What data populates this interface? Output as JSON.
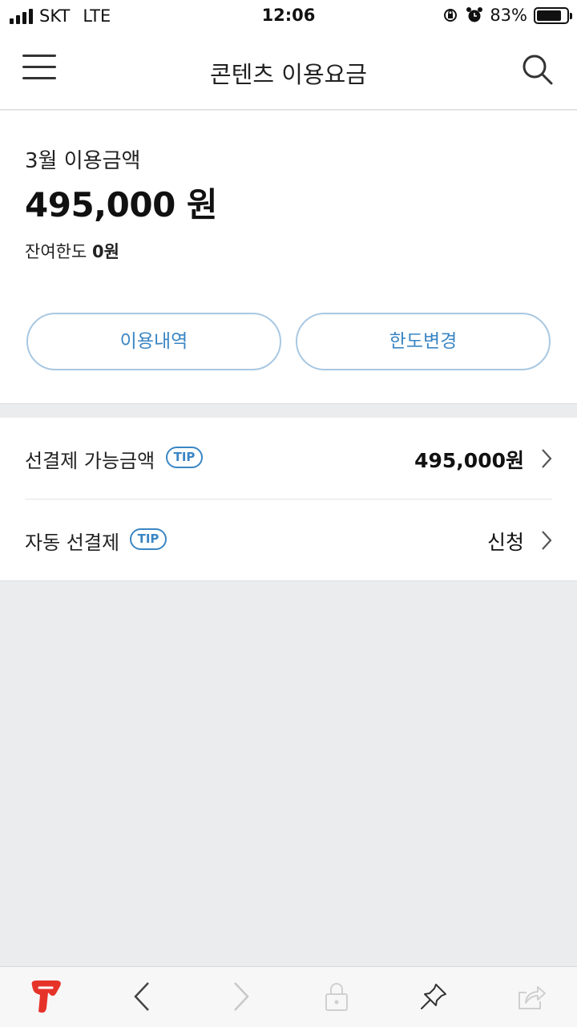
{
  "status_bar": {
    "carrier": "SKT",
    "network": "LTE",
    "time": "12:06",
    "battery": "83%",
    "battery_level": 0.83
  },
  "header": {
    "title": "콘텐츠 이용요금",
    "menu_icon": "hamburger-menu-icon",
    "search_icon": "search-icon"
  },
  "usage": {
    "month_label": "3월 이용금액",
    "amount": "495,000 원",
    "remaining_label": "잔여한도",
    "remaining_value": "0원",
    "history_button": "이용내역",
    "limit_button": "한도변경"
  },
  "prepay": {
    "rows": [
      {
        "label": "선결제 가능금액",
        "tip": "TIP",
        "value": "495,000원"
      },
      {
        "label": "자동 선결제",
        "tip": "TIP",
        "value": "신청"
      }
    ]
  },
  "toolbar": {
    "icons": [
      "t-logo-icon",
      "back-arrow-icon",
      "forward-arrow-icon",
      "lock-icon",
      "pin-icon",
      "share-icon"
    ]
  },
  "colors": {
    "accent": "#3a86c4",
    "button_border": "#a9c8e2",
    "brand_red": "#e6332a",
    "background": "#ebecee"
  }
}
